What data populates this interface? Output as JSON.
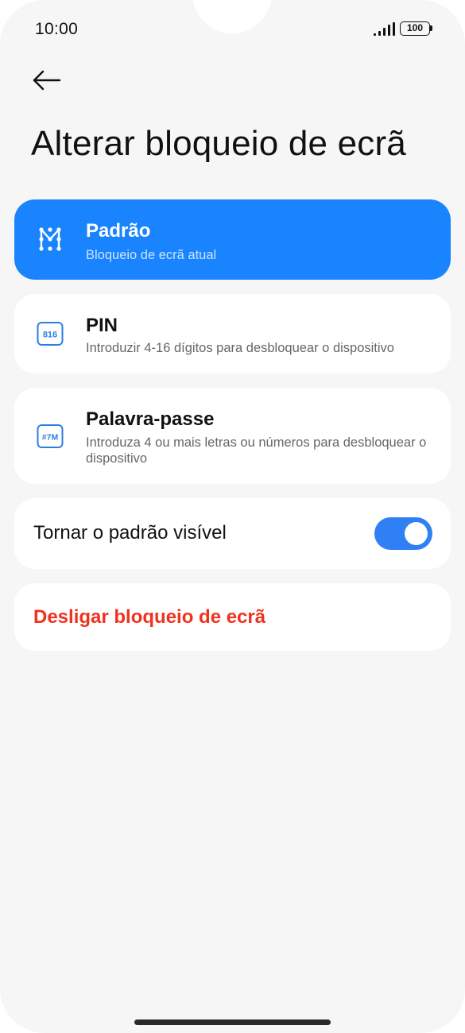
{
  "status_bar": {
    "time": "10:00",
    "battery": "100"
  },
  "header": {
    "back_icon": "arrow-left-icon",
    "title": "Alterar bloqueio de ecrã"
  },
  "options": [
    {
      "icon": "pattern-icon",
      "title": "Padrão",
      "subtitle": "Bloqueio de ecrã atual",
      "selected": true
    },
    {
      "icon": "pin-icon",
      "icon_text": "816",
      "title": "PIN",
      "subtitle": "Introduzir 4-16 dígitos para desbloquear o dispositivo",
      "selected": false
    },
    {
      "icon": "password-icon",
      "icon_text": "#7M",
      "title": "Palavra-passe",
      "subtitle": "Introduza 4 ou mais letras ou números para desbloquear o dispositivo",
      "selected": false
    }
  ],
  "toggle": {
    "label": "Tornar o padrão visível",
    "on": true
  },
  "disable": {
    "label": "Desligar bloqueio de ecrã"
  },
  "colors": {
    "background": "#f6f6f6",
    "accent": "#1a84ff",
    "toggle_on": "#2f80f5",
    "danger": "#f0311e",
    "icon_blue": "#2a7fe6"
  }
}
